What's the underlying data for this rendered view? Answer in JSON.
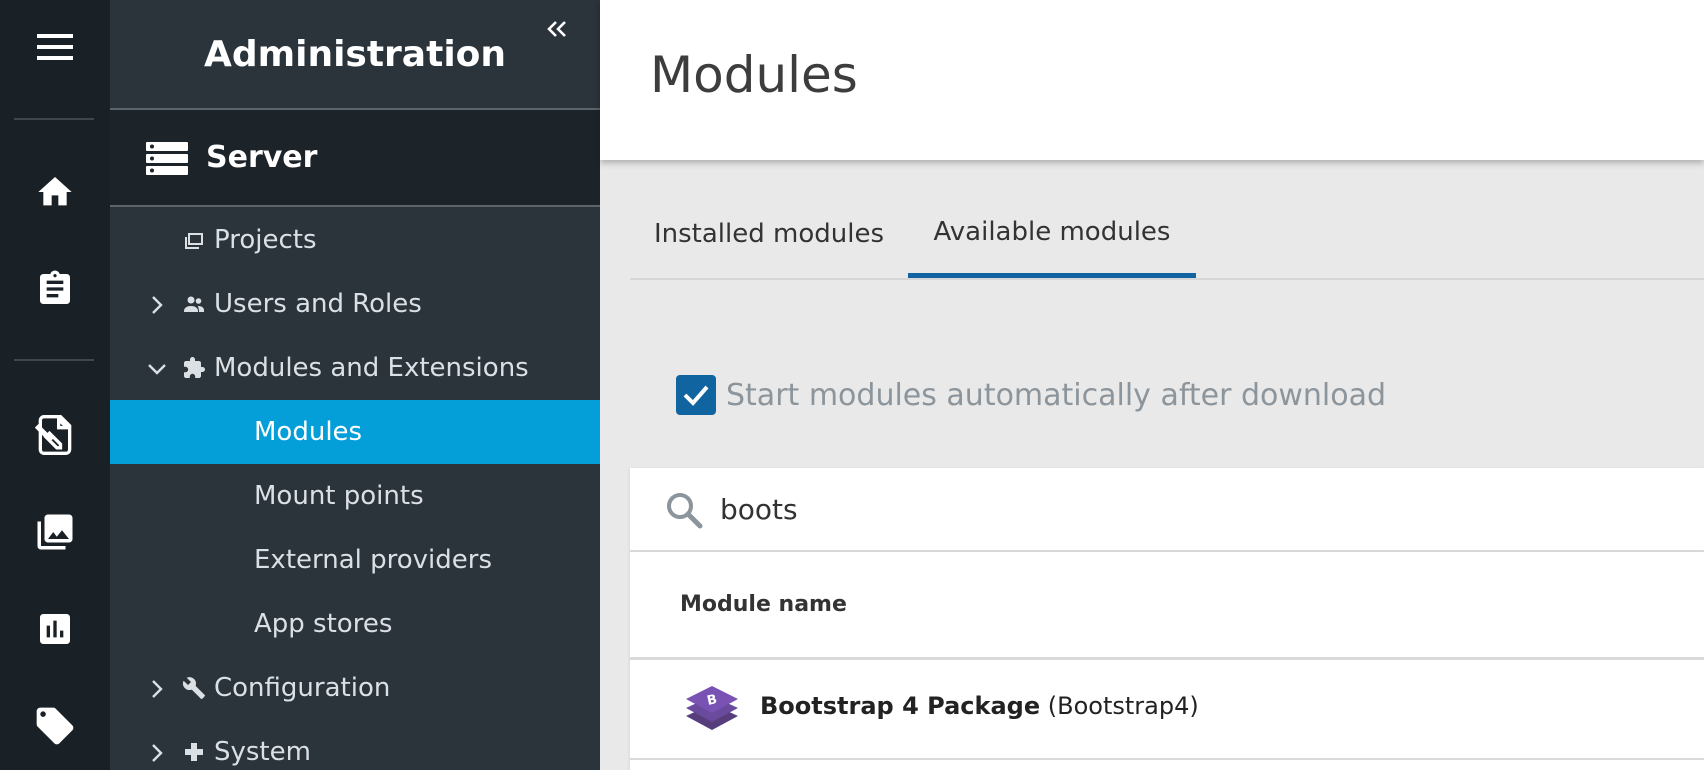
{
  "rail": {
    "icons": [
      "menu-icon",
      "home-icon",
      "clipboard-icon",
      "edit-document-icon",
      "photo-library-icon",
      "bar-chart-icon",
      "tag-icon"
    ]
  },
  "sidebar": {
    "title": "Administration",
    "section": "Server",
    "items": [
      {
        "label": "Projects",
        "icon": "projects-icon"
      },
      {
        "label": "Users and Roles",
        "icon": "users-icon",
        "expander": "collapsed"
      },
      {
        "label": "Modules and Extensions",
        "icon": "puzzle-icon",
        "expander": "expanded"
      },
      {
        "label": "Modules"
      },
      {
        "label": "Mount points"
      },
      {
        "label": "External providers"
      },
      {
        "label": "App stores"
      },
      {
        "label": "Configuration",
        "icon": "wrench-icon",
        "expander": "collapsed"
      },
      {
        "label": "System",
        "icon": "system-icon",
        "expander": "collapsed"
      }
    ]
  },
  "header": {
    "title": "Modules"
  },
  "tabs": [
    {
      "label": "Installed modules",
      "active": false
    },
    {
      "label": "Available modules",
      "active": true
    }
  ],
  "options": {
    "auto_start_label": "Start modules automatically after download",
    "auto_start_checked": true
  },
  "search": {
    "value": "boots"
  },
  "table": {
    "header": "Module name",
    "rows": [
      {
        "name": "Bootstrap 4 Package",
        "id": "(Bootstrap4)"
      }
    ]
  },
  "colors": {
    "rail_bg": "#1a2126",
    "sidebar_bg": "#2b333b",
    "active_item": "#049fd9",
    "accent": "#1064a0",
    "bootstrap_purple": "#7952b3"
  }
}
